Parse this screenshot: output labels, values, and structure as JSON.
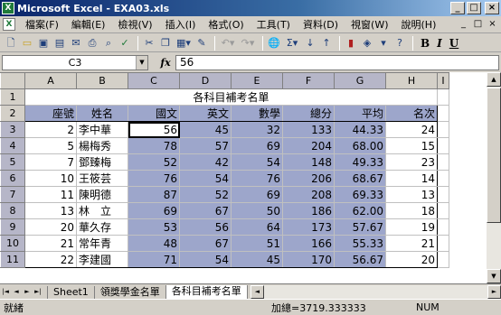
{
  "window": {
    "title": "Microsoft Excel - EXA03.xls",
    "app_icon": "X",
    "minimize": "_",
    "restore": "□",
    "close": "×"
  },
  "menu": {
    "doc_icon": "X",
    "items": [
      "檔案(F)",
      "編輯(E)",
      "檢視(V)",
      "插入(I)",
      "格式(O)",
      "工具(T)",
      "資料(D)",
      "視窗(W)",
      "說明(H)"
    ],
    "min": "_",
    "restore": "□",
    "close": "×"
  },
  "toolbar": {
    "icons": [
      "new-icon",
      "open-icon",
      "save-icon",
      "permission-icon",
      "email-icon",
      "print-icon",
      "print-preview-icon",
      "spelling-icon",
      "cut-icon",
      "copy-icon",
      "paste-icon",
      "format-painter-icon",
      "undo-icon",
      "redo-icon",
      "hyperlink-icon",
      "autosum-icon",
      "sort-ascending-icon",
      "sort-descending-icon",
      "chart-wizard-icon",
      "drawing-icon",
      "zoom-icon",
      "help-icon"
    ],
    "bold_label": "B",
    "italic_label": "I",
    "underline_label": "U"
  },
  "formula_bar": {
    "name_box": "C3",
    "fx_label": "fx",
    "value": "56"
  },
  "sheet": {
    "columns": [
      "A",
      "B",
      "C",
      "D",
      "E",
      "F",
      "G",
      "H",
      "I"
    ],
    "title": "各科目補考名單",
    "headers": [
      "座號",
      "姓名",
      "國文",
      "英文",
      "數學",
      "總分",
      "平均",
      "名次"
    ],
    "rows": [
      {
        "row": "3",
        "seat": "2",
        "name": "李中華",
        "chinese": "56",
        "english": "45",
        "math": "32",
        "total": "133",
        "avg": "44.33",
        "rank": "24"
      },
      {
        "row": "4",
        "seat": "5",
        "name": "楊梅秀",
        "chinese": "78",
        "english": "57",
        "math": "69",
        "total": "204",
        "avg": "68.00",
        "rank": "15"
      },
      {
        "row": "5",
        "seat": "7",
        "name": "鄧臻梅",
        "chinese": "52",
        "english": "42",
        "math": "54",
        "total": "148",
        "avg": "49.33",
        "rank": "23"
      },
      {
        "row": "6",
        "seat": "10",
        "name": "王筱芸",
        "chinese": "76",
        "english": "54",
        "math": "76",
        "total": "206",
        "avg": "68.67",
        "rank": "14"
      },
      {
        "row": "7",
        "seat": "11",
        "name": "陳明德",
        "chinese": "87",
        "english": "52",
        "math": "69",
        "total": "208",
        "avg": "69.33",
        "rank": "13"
      },
      {
        "row": "8",
        "seat": "13",
        "name": "林　立",
        "chinese": "69",
        "english": "67",
        "math": "50",
        "total": "186",
        "avg": "62.00",
        "rank": "18"
      },
      {
        "row": "9",
        "seat": "20",
        "name": "華久存",
        "chinese": "53",
        "english": "56",
        "math": "64",
        "total": "173",
        "avg": "57.67",
        "rank": "19"
      },
      {
        "row": "10",
        "seat": "21",
        "name": "常年青",
        "chinese": "48",
        "english": "67",
        "math": "51",
        "total": "166",
        "avg": "55.33",
        "rank": "21"
      },
      {
        "row": "11",
        "seat": "22",
        "name": "李建國",
        "chinese": "71",
        "english": "54",
        "math": "45",
        "total": "170",
        "avg": "56.67",
        "rank": "20"
      }
    ],
    "row_headers": [
      "1",
      "2",
      "3",
      "4",
      "5",
      "6",
      "7",
      "8",
      "9",
      "10",
      "11"
    ]
  },
  "tabs": [
    "Sheet1",
    "領獎學金名單",
    "各科目補考名單"
  ],
  "tab_nav": [
    "|◄",
    "◄",
    "►",
    "►|"
  ],
  "status": {
    "ready": "就緒",
    "sum": "加總=3719.333333",
    "num": "NUM"
  }
}
